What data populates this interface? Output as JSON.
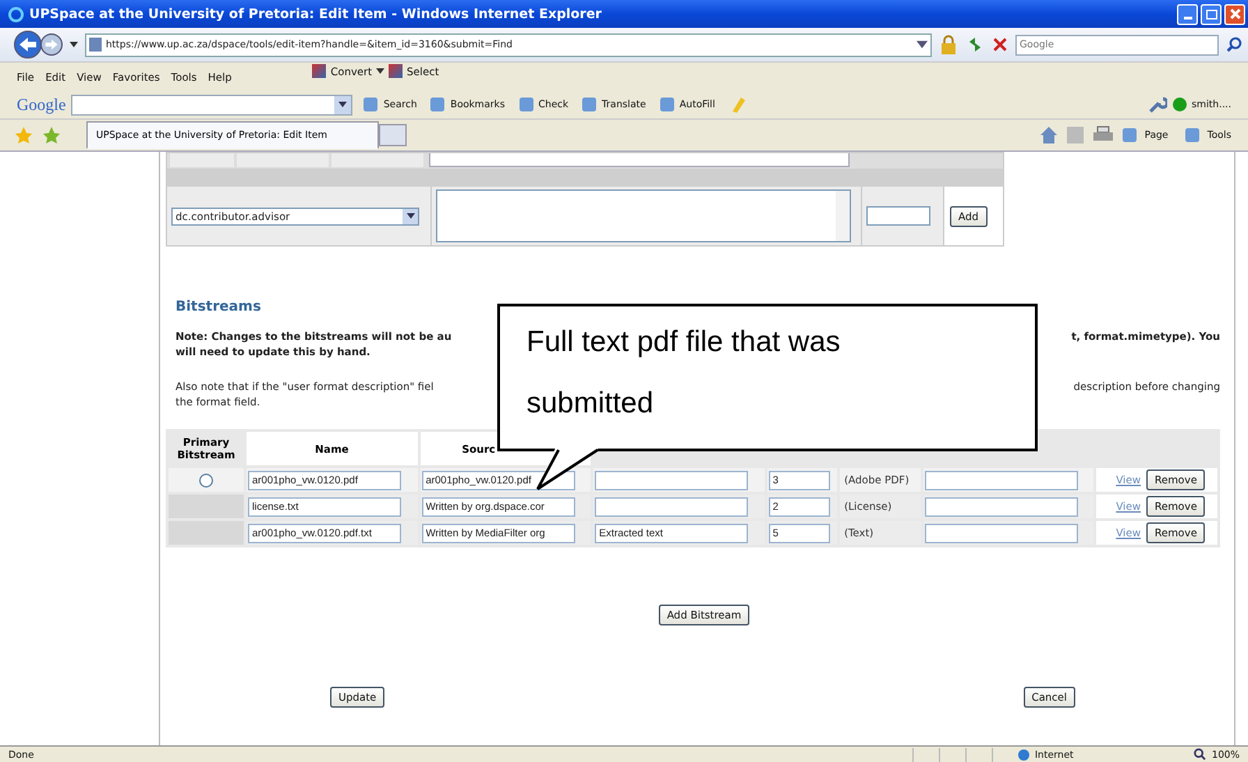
{
  "window": {
    "title": "UPSpace at the University of Pretoria: Edit Item - Windows Internet Explorer"
  },
  "address_bar": {
    "url": "https://www.up.ac.za/dspace/tools/edit-item?handle=&item_id=3160&submit=Find"
  },
  "search_box": {
    "placeholder": "Google"
  },
  "menu": [
    "File",
    "Edit",
    "View",
    "Favorites",
    "Tools",
    "Help"
  ],
  "pdf_toolbar": [
    "Convert",
    "Select"
  ],
  "google_toolbar": {
    "logo": "Google",
    "buttons": [
      "Search",
      "Bookmarks",
      "Check",
      "Translate",
      "AutoFill"
    ],
    "user": "smith...."
  },
  "tabs": [
    {
      "label": "UPSpace at the University of Pretoria: Edit Item",
      "selected": true
    }
  ],
  "command_bar": [
    "Page",
    "Tools"
  ],
  "metadata_row": {
    "field": "dc.contributor.advisor",
    "button": "Add"
  },
  "bitstreams": {
    "heading": "Bitstreams",
    "note_left": "Note: Changes to the bitstreams will not be au",
    "note_right": "t, format.mimetype). You",
    "note_line2": "will need to update this by hand.",
    "also_left": "Also note that if the \"user format description\" fiel",
    "also_right": "description before changing",
    "also_line2": "the format field.",
    "columns": [
      "Primary Bitstream",
      "Name",
      "Sourc"
    ],
    "rows": [
      {
        "selected": false,
        "name": "ar001pho_vw.0120.pdf",
        "source": "ar001pho_vw.0120.pdf",
        "description": "",
        "format_id": "3",
        "format": "(Adobe PDF)",
        "view": "View",
        "remove": "Remove"
      },
      {
        "name": "license.txt",
        "source": "Written by org.dspace.cor",
        "description": "",
        "format_id": "2",
        "format": "(License)",
        "view": "View",
        "remove": "Remove"
      },
      {
        "name": "ar001pho_vw.0120.pdf.txt",
        "source": "Written by MediaFilter org",
        "description": "Extracted text",
        "format_id": "5",
        "format": "(Text)",
        "view": "View",
        "remove": "Remove"
      }
    ]
  },
  "callout": "Full text pdf file that was submitted",
  "buttons": {
    "add": "Add Bitstream",
    "update": "Update",
    "cancel": "Cancel"
  },
  "status_bar": {
    "status": "Done",
    "zone": "Internet",
    "zoom": "100%"
  }
}
